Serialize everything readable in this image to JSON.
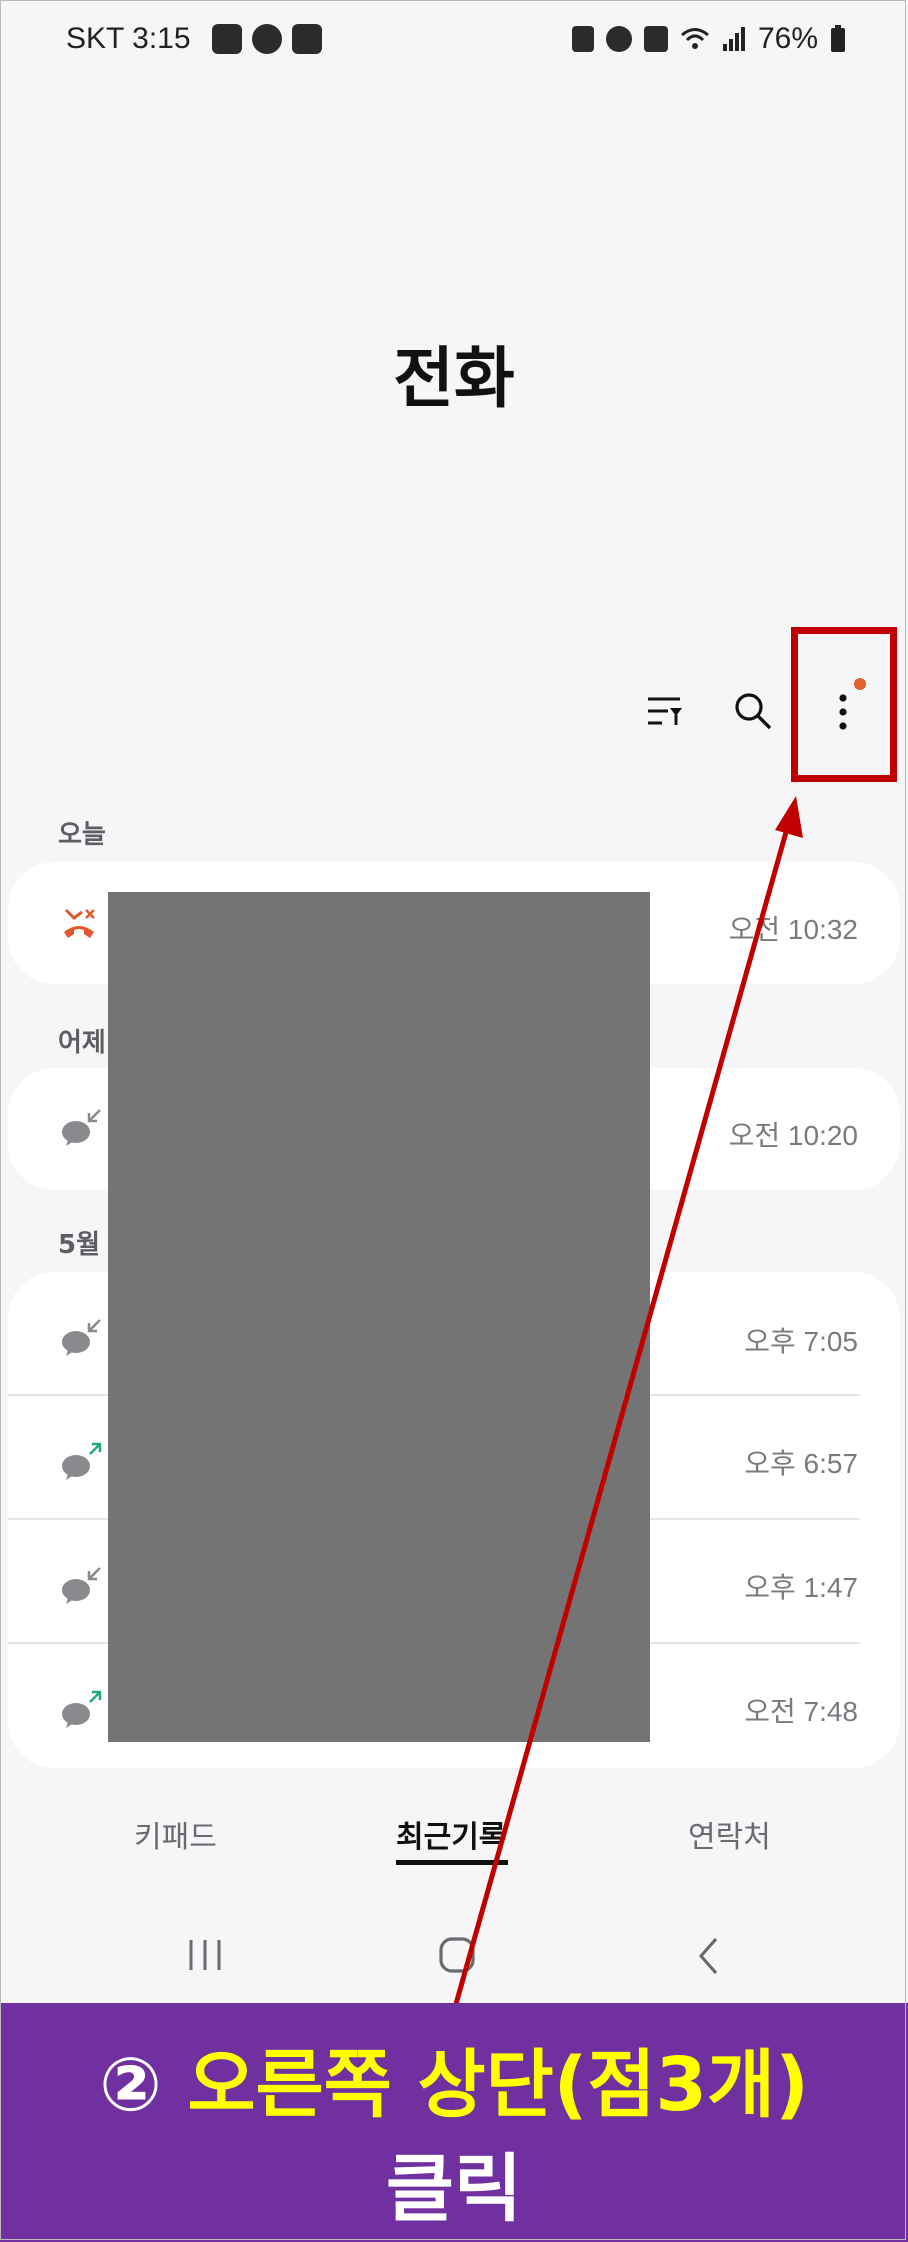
{
  "status_bar": {
    "carrier_time": "SKT 3:15",
    "battery": "76%",
    "notification_icons": [
      "gallery-icon",
      "kakaotalk-icon",
      "kyobo-icon"
    ],
    "system_icons": [
      "battery-saver-icon",
      "alarm-icon",
      "mute-icon",
      "wifi-icon",
      "signal-icon",
      "battery-icon"
    ]
  },
  "header": {
    "title": "전화"
  },
  "toolbar": {
    "filter_icon": "filter-icon",
    "search_icon": "search-icon",
    "more_icon": "more-options-icon",
    "badge_color": "#e0622c"
  },
  "sections": {
    "today": "오늘",
    "yesterday": "어제",
    "may": "5월"
  },
  "calls": {
    "today": [
      {
        "type": "rejected",
        "time": "오전 10:32"
      }
    ],
    "yesterday": [
      {
        "type": "incoming",
        "time": "오전 10:20"
      }
    ],
    "may": [
      {
        "type": "incoming",
        "time": "오후 7:05"
      },
      {
        "type": "outgoing",
        "time": "오후 6:57"
      },
      {
        "type": "incoming",
        "time": "오후 1:47"
      },
      {
        "type": "outgoing",
        "time": "오전 7:48"
      }
    ]
  },
  "tabs": {
    "keypad": "키패드",
    "recent": "최근기록",
    "contacts": "연락처"
  },
  "annotation": {
    "step": "②",
    "line1": "오른쪽 상단(점3개)",
    "line2": "클릭",
    "highlight_color": "#c00000",
    "banner_color": "#7030a0"
  }
}
